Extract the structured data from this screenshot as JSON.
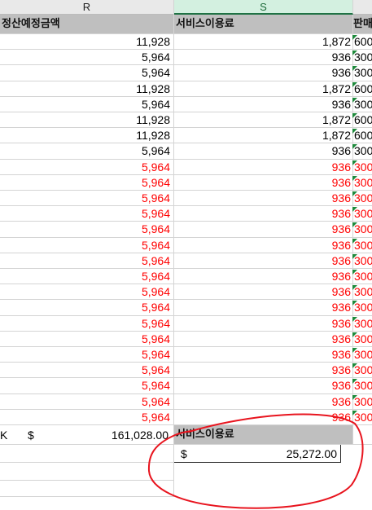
{
  "columns": {
    "r": "R",
    "s": "S"
  },
  "header": {
    "r": "정산예정금액",
    "s": "서비스이용료",
    "t": "판매"
  },
  "rows": [
    {
      "r": "11,928",
      "s": "1,872",
      "t": "600",
      "red": false
    },
    {
      "r": "5,964",
      "s": "936",
      "t": "300",
      "red": false
    },
    {
      "r": "5,964",
      "s": "936",
      "t": "300",
      "red": false
    },
    {
      "r": "11,928",
      "s": "1,872",
      "t": "600",
      "red": false
    },
    {
      "r": "5,964",
      "s": "936",
      "t": "300",
      "red": false
    },
    {
      "r": "11,928",
      "s": "1,872",
      "t": "600",
      "red": false
    },
    {
      "r": "11,928",
      "s": "1,872",
      "t": "600",
      "red": false
    },
    {
      "r": "5,964",
      "s": "936",
      "t": "300",
      "red": false
    },
    {
      "r": "5,964",
      "s": "936",
      "t": "300",
      "red": true
    },
    {
      "r": "5,964",
      "s": "936",
      "t": "300",
      "red": true
    },
    {
      "r": "5,964",
      "s": "936",
      "t": "300",
      "red": true
    },
    {
      "r": "5,964",
      "s": "936",
      "t": "300",
      "red": true
    },
    {
      "r": "5,964",
      "s": "936",
      "t": "300",
      "red": true
    },
    {
      "r": "5,964",
      "s": "936",
      "t": "300",
      "red": true
    },
    {
      "r": "5,964",
      "s": "936",
      "t": "300",
      "red": true
    },
    {
      "r": "5,964",
      "s": "936",
      "t": "300",
      "red": true
    },
    {
      "r": "5,964",
      "s": "936",
      "t": "300",
      "red": true
    },
    {
      "r": "5,964",
      "s": "936",
      "t": "300",
      "red": true
    },
    {
      "r": "5,964",
      "s": "936",
      "t": "300",
      "red": true
    },
    {
      "r": "5,964",
      "s": "936",
      "t": "300",
      "red": true
    },
    {
      "r": "5,964",
      "s": "936",
      "t": "300",
      "red": true
    },
    {
      "r": "5,964",
      "s": "936",
      "t": "300",
      "red": true
    },
    {
      "r": "5,964",
      "s": "936",
      "t": "300",
      "red": true
    },
    {
      "r": "5,964",
      "s": "936",
      "t": "300",
      "red": true
    },
    {
      "r": "5,964",
      "s": "936",
      "t": "300",
      "red": true
    }
  ],
  "summary": {
    "left_label": "K",
    "currency": "$",
    "r_total": "161,028.00",
    "s_header": "서비스이용료",
    "s_total": "25,272.00"
  },
  "annotation": {
    "color": "#e8141e"
  }
}
